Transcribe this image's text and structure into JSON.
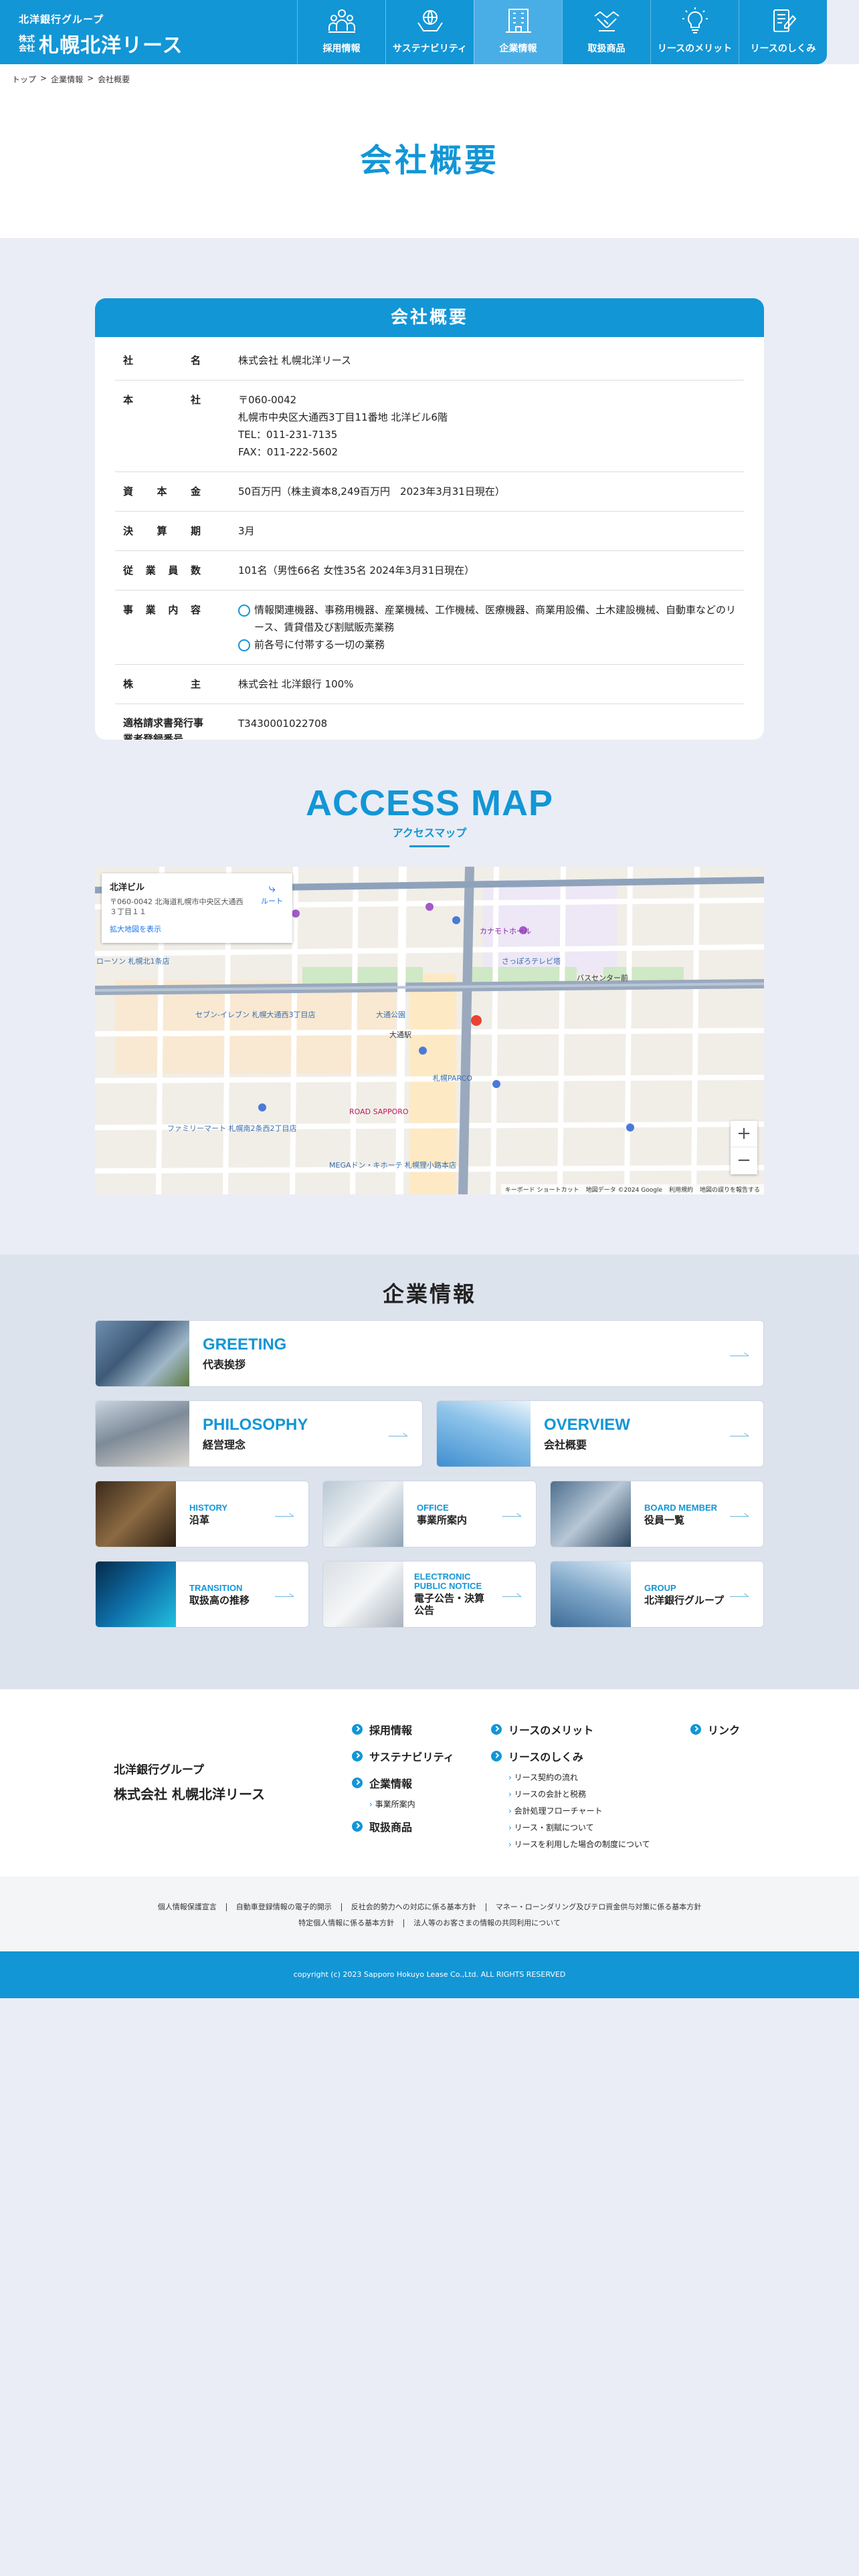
{
  "header": {
    "group": "北洋銀行グループ",
    "kabushiki": "株式会社",
    "company": "札幌北洋リース",
    "nav": [
      {
        "label": "採用情報",
        "icon": "people-icon"
      },
      {
        "label": "サステナビリティ",
        "icon": "globe-hands-icon"
      },
      {
        "label": "企業情報",
        "icon": "building-icon"
      },
      {
        "label": "取扱商品",
        "icon": "handshake-icon"
      },
      {
        "label": "リースのメリット",
        "icon": "lightbulb-icon"
      },
      {
        "label": "リースのしくみ",
        "icon": "document-pen-icon"
      }
    ]
  },
  "breadcrumb": [
    "トップ",
    ">",
    "企業情報",
    ">",
    "会社概要"
  ],
  "page_title": "会社概要",
  "overview": {
    "heading": "会社概要",
    "rows": {
      "name_key": [
        "社",
        "名"
      ],
      "name_val": "株式会社 札幌北洋リース",
      "hq_key": [
        "本",
        "社"
      ],
      "hq_zip": "〒060-0042",
      "hq_addr": "札幌市中央区大通西3丁目11番地 北洋ビル6階",
      "hq_tel": "TEL：011-231-7135",
      "hq_fax": "FAX：011-222-5602",
      "capital_key": [
        "資",
        "本",
        "金"
      ],
      "capital_val": "50百万円（株主資本8,249百万円　2023年3月31日現在）",
      "fiscal_key": [
        "決",
        "算",
        "期"
      ],
      "fiscal_val": "3月",
      "staff_key": [
        "従",
        "業",
        "員",
        "数"
      ],
      "staff_val": "101名（男性66名 女性35名 2024年3月31日現在）",
      "biz_key": [
        "事",
        "業",
        "内",
        "容"
      ],
      "biz_1": "情報関連機器、事務用機器、産業機械、工作機械、医療機器、商業用設備、土木建設機械、自動車などのリース、賃貸借及び割賦販売業務",
      "biz_2": "前各号に付帯する一切の業務",
      "holder_key": [
        "株",
        "主"
      ],
      "holder_val": "株式会社 北洋銀行 100%",
      "invoice_key": "適格請求書発行事業者登録番号",
      "invoice_val": "T3430001022708"
    }
  },
  "access": {
    "title": "ACCESS MAP",
    "subtitle": "アクセスマップ",
    "map_box_title": "北洋ビル",
    "map_box_addr": "〒060-0042 北海道札幌市中央区大通西３丁目１１",
    "map_box_link": "拡大地図を表示",
    "map_box_route": "ルート",
    "zoom_in": "+",
    "zoom_out": "−",
    "footer": [
      "キーボード ショートカット",
      "地図データ ©2024 Google",
      "利用規約",
      "地図の誤りを報告する"
    ],
    "labels": [
      "大通公園",
      "札幌PARCO",
      "さっぽろテレビ塔",
      "バスセンター前",
      "ローソン 札幌北1条店",
      "セブン-イレブン 札幌大通西3丁目店",
      "ファミリーマート 札幌南2条西2丁目店",
      "ROAD SAPPORO",
      "MEGAドン・キホーテ 札幌狸小路本店",
      "カナモトホール",
      "大通駅"
    ]
  },
  "info": {
    "title": "企業情報",
    "tiles": [
      {
        "en": "GREETING",
        "ja": "代表挨拶"
      },
      {
        "en": "PHILOSOPHY",
        "ja": "経営理念"
      },
      {
        "en": "OVERVIEW",
        "ja": "会社概要"
      },
      {
        "en": "HISTORY",
        "ja": "沿革"
      },
      {
        "en": "OFFICE",
        "ja": "事業所案内"
      },
      {
        "en": "BOARD MEMBER",
        "ja": "役員一覧"
      },
      {
        "en": "TRANSITION",
        "ja": "取扱高の推移"
      },
      {
        "en": "ELECTRONIC PUBLIC NOTICE",
        "ja": "電子公告・決算公告"
      },
      {
        "en": "GROUP",
        "ja": "北洋銀行グループ"
      }
    ]
  },
  "footer": {
    "group": "北洋銀行グループ",
    "company": "株式会社 札幌北洋リース",
    "col1": [
      "採用情報",
      "サステナビリティ",
      "企業情報",
      "取扱商品"
    ],
    "col1_sub": [
      "事業所案内"
    ],
    "col2": [
      "リースのメリット",
      "リースのしくみ"
    ],
    "col2_sub": [
      "リース契約の流れ",
      "リースの会計と税務",
      "会計処理フローチャート",
      "リース・割賦について",
      "リースを利用した場合の制度について"
    ],
    "col3": [
      "リンク"
    ],
    "links_1": [
      "個人情報保護宣言",
      "自動車登録情報の電子的開示",
      "反社会的勢力への対応に係る基本方針",
      "マネー・ローンダリング及びテロ資金供与対策に係る基本方針"
    ],
    "links_2": [
      "特定個人情報に係る基本方針",
      "法人等のお客さまの情報の共同利用について"
    ],
    "copyright": "copyright (c) 2023 Sapporo Hokuyo Lease Co.,Ltd. ALL RIGHTS RESERVED"
  }
}
